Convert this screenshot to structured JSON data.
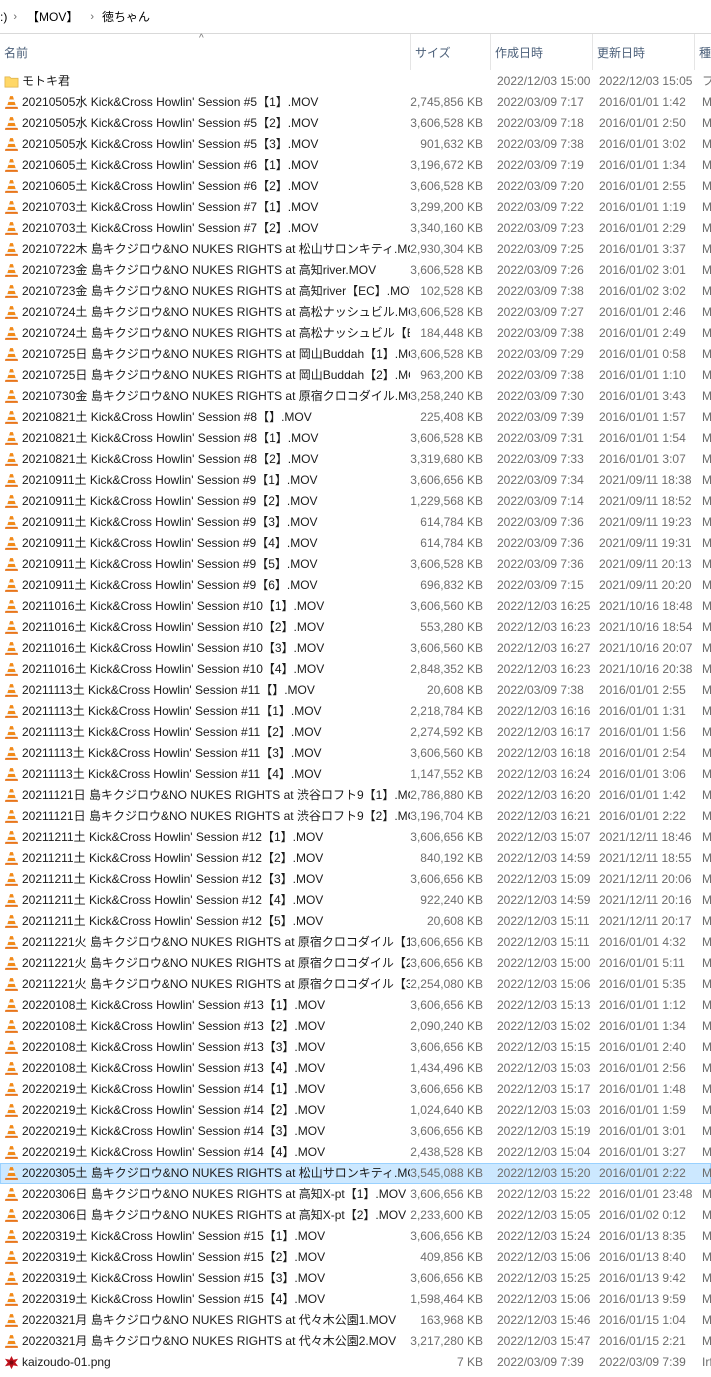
{
  "breadcrumb": {
    "items": [
      ":)",
      "【MOV】",
      "徳ちゃん"
    ]
  },
  "columns": {
    "name": "名前",
    "size": "サイズ",
    "created": "作成日時",
    "modified": "更新日時",
    "type": "種"
  },
  "sort_indicator": "^",
  "selected_index": 52,
  "colors": {
    "selection": "#cce8ff",
    "vlc_orange": "#f08010",
    "folder": "#ffd766"
  },
  "rows": [
    {
      "icon": "folder",
      "name": "モトキ君",
      "size": "",
      "created": "2022/12/03 15:00",
      "modified": "2022/12/03 15:05",
      "type": "フ"
    },
    {
      "icon": "vlc",
      "name": "20210505水 Kick&Cross Howlin' Session #5【1】.MOV",
      "size": "2,745,856 KB",
      "created": "2022/03/09 7:17",
      "modified": "2016/01/01 1:42",
      "type": "M"
    },
    {
      "icon": "vlc",
      "name": "20210505水 Kick&Cross Howlin' Session #5【2】.MOV",
      "size": "3,606,528 KB",
      "created": "2022/03/09 7:18",
      "modified": "2016/01/01 2:50",
      "type": "M"
    },
    {
      "icon": "vlc",
      "name": "20210505水 Kick&Cross Howlin' Session #5【3】.MOV",
      "size": "901,632 KB",
      "created": "2022/03/09 7:38",
      "modified": "2016/01/01 3:02",
      "type": "M"
    },
    {
      "icon": "vlc",
      "name": "20210605土 Kick&Cross Howlin' Session #6【1】.MOV",
      "size": "3,196,672 KB",
      "created": "2022/03/09 7:19",
      "modified": "2016/01/01 1:34",
      "type": "M"
    },
    {
      "icon": "vlc",
      "name": "20210605土 Kick&Cross Howlin' Session #6【2】.MOV",
      "size": "3,606,528 KB",
      "created": "2022/03/09 7:20",
      "modified": "2016/01/01 2:55",
      "type": "M"
    },
    {
      "icon": "vlc",
      "name": "20210703土 Kick&Cross Howlin' Session #7【1】.MOV",
      "size": "3,299,200 KB",
      "created": "2022/03/09 7:22",
      "modified": "2016/01/01 1:19",
      "type": "M"
    },
    {
      "icon": "vlc",
      "name": "20210703土 Kick&Cross Howlin' Session #7【2】.MOV",
      "size": "3,340,160 KB",
      "created": "2022/03/09 7:23",
      "modified": "2016/01/01 2:29",
      "type": "M"
    },
    {
      "icon": "vlc",
      "name": "20210722木 島キクジロウ&NO NUKES RIGHTS at 松山サロンキティ.MOV",
      "size": "2,930,304 KB",
      "created": "2022/03/09 7:25",
      "modified": "2016/01/01 3:37",
      "type": "M"
    },
    {
      "icon": "vlc",
      "name": "20210723金 島キクジロウ&NO NUKES RIGHTS at 高知river.MOV",
      "size": "3,606,528 KB",
      "created": "2022/03/09 7:26",
      "modified": "2016/01/02 3:01",
      "type": "M"
    },
    {
      "icon": "vlc",
      "name": "20210723金 島キクジロウ&NO NUKES RIGHTS at 高知river【EC】.MOV",
      "size": "102,528 KB",
      "created": "2022/03/09 7:38",
      "modified": "2016/01/02 3:02",
      "type": "M"
    },
    {
      "icon": "vlc",
      "name": "20210724土 島キクジロウ&NO NUKES RIGHTS at 高松ナッシュビル.MOV",
      "size": "3,606,528 KB",
      "created": "2022/03/09 7:27",
      "modified": "2016/01/01 2:46",
      "type": "M"
    },
    {
      "icon": "vlc",
      "name": "20210724土 島キクジロウ&NO NUKES RIGHTS at 高松ナッシュビル【EC】.MOV",
      "size": "184,448 KB",
      "created": "2022/03/09 7:38",
      "modified": "2016/01/01 2:49",
      "type": "M"
    },
    {
      "icon": "vlc",
      "name": "20210725日 島キクジロウ&NO NUKES RIGHTS at 岡山Buddah【1】.MOV",
      "size": "3,606,528 KB",
      "created": "2022/03/09 7:29",
      "modified": "2016/01/01 0:58",
      "type": "M"
    },
    {
      "icon": "vlc",
      "name": "20210725日 島キクジロウ&NO NUKES RIGHTS at 岡山Buddah【2】.MOV",
      "size": "963,200 KB",
      "created": "2022/03/09 7:38",
      "modified": "2016/01/01 1:10",
      "type": "M"
    },
    {
      "icon": "vlc",
      "name": "20210730金 島キクジロウ&NO NUKES RIGHTS at 原宿クロコダイル.MOV",
      "size": "3,258,240 KB",
      "created": "2022/03/09 7:30",
      "modified": "2016/01/01 3:43",
      "type": "M"
    },
    {
      "icon": "vlc",
      "name": "20210821土 Kick&Cross Howlin' Session #8【】.MOV",
      "size": "225,408 KB",
      "created": "2022/03/09 7:39",
      "modified": "2016/01/01 1:57",
      "type": "M"
    },
    {
      "icon": "vlc",
      "name": "20210821土 Kick&Cross Howlin' Session #8【1】.MOV",
      "size": "3,606,528 KB",
      "created": "2022/03/09 7:31",
      "modified": "2016/01/01 1:54",
      "type": "M"
    },
    {
      "icon": "vlc",
      "name": "20210821土 Kick&Cross Howlin' Session #8【2】.MOV",
      "size": "3,319,680 KB",
      "created": "2022/03/09 7:33",
      "modified": "2016/01/01 3:07",
      "type": "M"
    },
    {
      "icon": "vlc",
      "name": "20210911土 Kick&Cross Howlin' Session #9【1】.MOV",
      "size": "3,606,656 KB",
      "created": "2022/03/09 7:34",
      "modified": "2021/09/11 18:38",
      "type": "M"
    },
    {
      "icon": "vlc",
      "name": "20210911土 Kick&Cross Howlin' Session #9【2】.MOV",
      "size": "1,229,568 KB",
      "created": "2022/03/09 7:14",
      "modified": "2021/09/11 18:52",
      "type": "M"
    },
    {
      "icon": "vlc",
      "name": "20210911土 Kick&Cross Howlin' Session #9【3】.MOV",
      "size": "614,784 KB",
      "created": "2022/03/09 7:36",
      "modified": "2021/09/11 19:23",
      "type": "M"
    },
    {
      "icon": "vlc",
      "name": "20210911土 Kick&Cross Howlin' Session #9【4】.MOV",
      "size": "614,784 KB",
      "created": "2022/03/09 7:36",
      "modified": "2021/09/11 19:31",
      "type": "M"
    },
    {
      "icon": "vlc",
      "name": "20210911土 Kick&Cross Howlin' Session #9【5】.MOV",
      "size": "3,606,528 KB",
      "created": "2022/03/09 7:36",
      "modified": "2021/09/11 20:13",
      "type": "M"
    },
    {
      "icon": "vlc",
      "name": "20210911土 Kick&Cross Howlin' Session #9【6】.MOV",
      "size": "696,832 KB",
      "created": "2022/03/09 7:15",
      "modified": "2021/09/11 20:20",
      "type": "M"
    },
    {
      "icon": "vlc",
      "name": "20211016土 Kick&Cross Howlin' Session #10【1】.MOV",
      "size": "3,606,560 KB",
      "created": "2022/12/03 16:25",
      "modified": "2021/10/16 18:48",
      "type": "M"
    },
    {
      "icon": "vlc",
      "name": "20211016土 Kick&Cross Howlin' Session #10【2】.MOV",
      "size": "553,280 KB",
      "created": "2022/12/03 16:23",
      "modified": "2021/10/16 18:54",
      "type": "M"
    },
    {
      "icon": "vlc",
      "name": "20211016土 Kick&Cross Howlin' Session #10【3】.MOV",
      "size": "3,606,560 KB",
      "created": "2022/12/03 16:27",
      "modified": "2021/10/16 20:07",
      "type": "M"
    },
    {
      "icon": "vlc",
      "name": "20211016土 Kick&Cross Howlin' Session #10【4】.MOV",
      "size": "2,848,352 KB",
      "created": "2022/12/03 16:23",
      "modified": "2021/10/16 20:38",
      "type": "M"
    },
    {
      "icon": "vlc",
      "name": "20211113土 Kick&Cross Howlin' Session #11【】.MOV",
      "size": "20,608 KB",
      "created": "2022/03/09 7:38",
      "modified": "2016/01/01 2:55",
      "type": "M"
    },
    {
      "icon": "vlc",
      "name": "20211113土 Kick&Cross Howlin' Session #11【1】.MOV",
      "size": "2,218,784 KB",
      "created": "2022/12/03 16:16",
      "modified": "2016/01/01 1:31",
      "type": "M"
    },
    {
      "icon": "vlc",
      "name": "20211113土 Kick&Cross Howlin' Session #11【2】.MOV",
      "size": "2,274,592 KB",
      "created": "2022/12/03 16:17",
      "modified": "2016/01/01 1:56",
      "type": "M"
    },
    {
      "icon": "vlc",
      "name": "20211113土 Kick&Cross Howlin' Session #11【3】.MOV",
      "size": "3,606,560 KB",
      "created": "2022/12/03 16:18",
      "modified": "2016/01/01 2:54",
      "type": "M"
    },
    {
      "icon": "vlc",
      "name": "20211113土 Kick&Cross Howlin' Session #11【4】.MOV",
      "size": "1,147,552 KB",
      "created": "2022/12/03 16:24",
      "modified": "2016/01/01 3:06",
      "type": "M"
    },
    {
      "icon": "vlc",
      "name": "20211121日 島キクジロウ&NO NUKES RIGHTS at 渋谷ロフト9【1】.MOV",
      "size": "2,786,880 KB",
      "created": "2022/12/03 16:20",
      "modified": "2016/01/01 1:42",
      "type": "M"
    },
    {
      "icon": "vlc",
      "name": "20211121日 島キクジロウ&NO NUKES RIGHTS at 渋谷ロフト9【2】.MOV",
      "size": "3,196,704 KB",
      "created": "2022/12/03 16:21",
      "modified": "2016/01/01 2:22",
      "type": "M"
    },
    {
      "icon": "vlc",
      "name": "20211211土 Kick&Cross Howlin' Session #12【1】.MOV",
      "size": "3,606,656 KB",
      "created": "2022/12/03 15:07",
      "modified": "2021/12/11 18:46",
      "type": "M"
    },
    {
      "icon": "vlc",
      "name": "20211211土 Kick&Cross Howlin' Session #12【2】.MOV",
      "size": "840,192 KB",
      "created": "2022/12/03 14:59",
      "modified": "2021/12/11 18:55",
      "type": "M"
    },
    {
      "icon": "vlc",
      "name": "20211211土 Kick&Cross Howlin' Session #12【3】.MOV",
      "size": "3,606,656 KB",
      "created": "2022/12/03 15:09",
      "modified": "2021/12/11 20:06",
      "type": "M"
    },
    {
      "icon": "vlc",
      "name": "20211211土 Kick&Cross Howlin' Session #12【4】.MOV",
      "size": "922,240 KB",
      "created": "2022/12/03 14:59",
      "modified": "2021/12/11 20:16",
      "type": "M"
    },
    {
      "icon": "vlc",
      "name": "20211211土 Kick&Cross Howlin' Session #12【5】.MOV",
      "size": "20,608 KB",
      "created": "2022/12/03 15:11",
      "modified": "2021/12/11 20:17",
      "type": "M"
    },
    {
      "icon": "vlc",
      "name": "20211221火 島キクジロウ&NO NUKES RIGHTS at 原宿クロコダイル【1】.MOV",
      "size": "3,606,656 KB",
      "created": "2022/12/03 15:11",
      "modified": "2016/01/01 4:32",
      "type": "M"
    },
    {
      "icon": "vlc",
      "name": "20211221火 島キクジロウ&NO NUKES RIGHTS at 原宿クロコダイル【2】.MOV",
      "size": "3,606,656 KB",
      "created": "2022/12/03 15:00",
      "modified": "2016/01/01 5:11",
      "type": "M"
    },
    {
      "icon": "vlc",
      "name": "20211221火 島キクジロウ&NO NUKES RIGHTS at 原宿クロコダイル【3】.MOV",
      "size": "2,254,080 KB",
      "created": "2022/12/03 15:06",
      "modified": "2016/01/01 5:35",
      "type": "M"
    },
    {
      "icon": "vlc",
      "name": "20220108土 Kick&Cross Howlin' Session #13【1】.MOV",
      "size": "3,606,656 KB",
      "created": "2022/12/03 15:13",
      "modified": "2016/01/01 1:12",
      "type": "M"
    },
    {
      "icon": "vlc",
      "name": "20220108土 Kick&Cross Howlin' Session #13【2】.MOV",
      "size": "2,090,240 KB",
      "created": "2022/12/03 15:02",
      "modified": "2016/01/01 1:34",
      "type": "M"
    },
    {
      "icon": "vlc",
      "name": "20220108土 Kick&Cross Howlin' Session #13【3】.MOV",
      "size": "3,606,656 KB",
      "created": "2022/12/03 15:15",
      "modified": "2016/01/01 2:40",
      "type": "M"
    },
    {
      "icon": "vlc",
      "name": "20220108土 Kick&Cross Howlin' Session #13【4】.MOV",
      "size": "1,434,496 KB",
      "created": "2022/12/03 15:03",
      "modified": "2016/01/01 2:56",
      "type": "M"
    },
    {
      "icon": "vlc",
      "name": "20220219土 Kick&Cross Howlin' Session #14【1】.MOV",
      "size": "3,606,656 KB",
      "created": "2022/12/03 15:17",
      "modified": "2016/01/01 1:48",
      "type": "M"
    },
    {
      "icon": "vlc",
      "name": "20220219土 Kick&Cross Howlin' Session #14【2】.MOV",
      "size": "1,024,640 KB",
      "created": "2022/12/03 15:03",
      "modified": "2016/01/01 1:59",
      "type": "M"
    },
    {
      "icon": "vlc",
      "name": "20220219土 Kick&Cross Howlin' Session #14【3】.MOV",
      "size": "3,606,656 KB",
      "created": "2022/12/03 15:19",
      "modified": "2016/01/01 3:01",
      "type": "M"
    },
    {
      "icon": "vlc",
      "name": "20220219土 Kick&Cross Howlin' Session #14【4】.MOV",
      "size": "2,438,528 KB",
      "created": "2022/12/03 15:04",
      "modified": "2016/01/01 3:27",
      "type": "M"
    },
    {
      "icon": "vlc",
      "name": "20220305土 島キクジロウ&NO NUKES RIGHTS at 松山サロンキティ.MOV",
      "size": "3,545,088 KB",
      "created": "2022/12/03 15:20",
      "modified": "2016/01/01 2:22",
      "type": "M"
    },
    {
      "icon": "vlc",
      "name": "20220306日 島キクジロウ&NO NUKES RIGHTS at 高知X-pt【1】.MOV",
      "size": "3,606,656 KB",
      "created": "2022/12/03 15:22",
      "modified": "2016/01/01 23:48",
      "type": "M"
    },
    {
      "icon": "vlc",
      "name": "20220306日 島キクジロウ&NO NUKES RIGHTS at 高知X-pt【2】.MOV",
      "size": "2,233,600 KB",
      "created": "2022/12/03 15:05",
      "modified": "2016/01/02 0:12",
      "type": "M"
    },
    {
      "icon": "vlc",
      "name": "20220319土 Kick&Cross Howlin' Session #15【1】.MOV",
      "size": "3,606,656 KB",
      "created": "2022/12/03 15:24",
      "modified": "2016/01/13 8:35",
      "type": "M"
    },
    {
      "icon": "vlc",
      "name": "20220319土 Kick&Cross Howlin' Session #15【2】.MOV",
      "size": "409,856 KB",
      "created": "2022/12/03 15:06",
      "modified": "2016/01/13 8:40",
      "type": "M"
    },
    {
      "icon": "vlc",
      "name": "20220319土 Kick&Cross Howlin' Session #15【3】.MOV",
      "size": "3,606,656 KB",
      "created": "2022/12/03 15:25",
      "modified": "2016/01/13 9:42",
      "type": "M"
    },
    {
      "icon": "vlc",
      "name": "20220319土 Kick&Cross Howlin' Session #15【4】.MOV",
      "size": "1,598,464 KB",
      "created": "2022/12/03 15:06",
      "modified": "2016/01/13 9:59",
      "type": "M"
    },
    {
      "icon": "vlc",
      "name": "20220321月 島キクジロウ&NO NUKES RIGHTS at 代々木公園1.MOV",
      "size": "163,968 KB",
      "created": "2022/12/03 15:46",
      "modified": "2016/01/15 1:04",
      "type": "M"
    },
    {
      "icon": "vlc",
      "name": "20220321月 島キクジロウ&NO NUKES RIGHTS at 代々木公園2.MOV",
      "size": "3,217,280 KB",
      "created": "2022/12/03 15:47",
      "modified": "2016/01/15 2:21",
      "type": "M"
    },
    {
      "icon": "png",
      "name": "kaizoudo-01.png",
      "size": "7 KB",
      "created": "2022/03/09 7:39",
      "modified": "2022/03/09 7:39",
      "type": "Irf"
    }
  ]
}
